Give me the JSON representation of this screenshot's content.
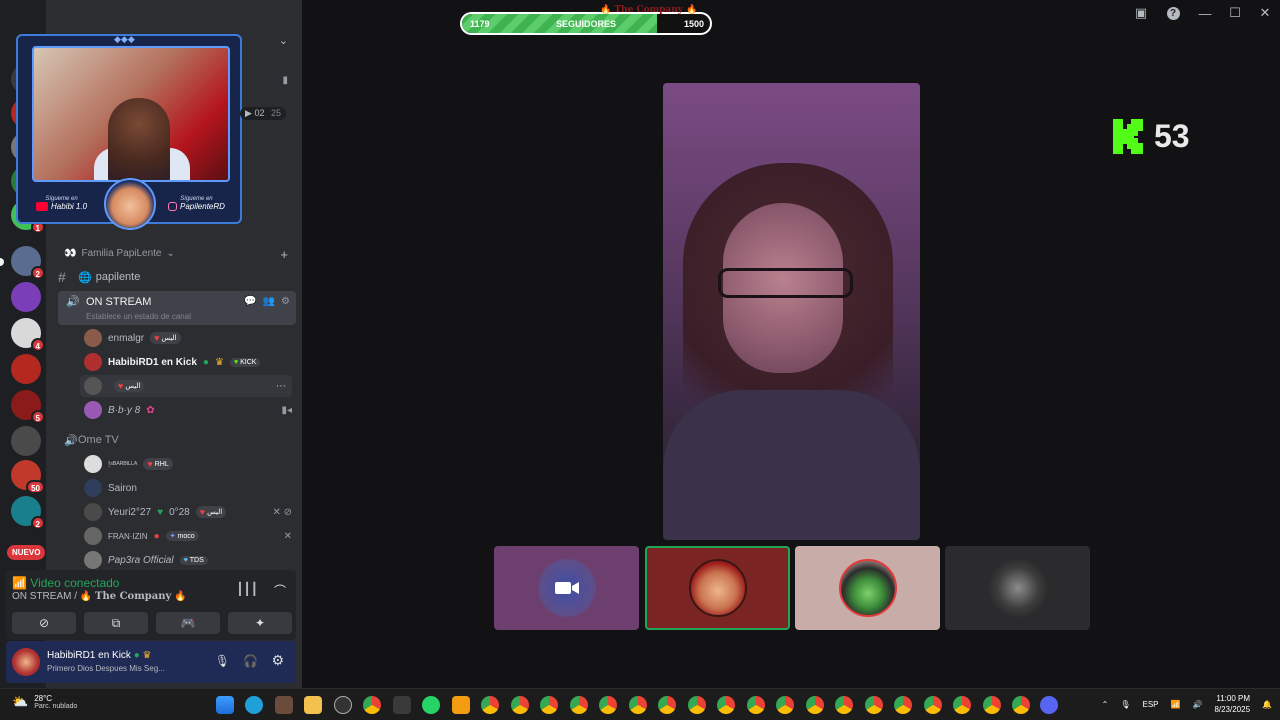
{
  "stream": {
    "follower_current": "1179",
    "follower_label": "SEGUIDORES",
    "follower_goal": "1500",
    "progress_fraction": 0.786,
    "banner_title": "The Company",
    "kick_count": "53"
  },
  "overlay": {
    "follow_left_small": "Sígueme en",
    "follow_left": "Habibi 1.0",
    "follow_right_small": "Sígueme en",
    "follow_right": "PapilenteRD",
    "cam_count": "02",
    "cam_count_2": "25"
  },
  "servers": {
    "badges": [
      "1",
      "2",
      "4",
      "5",
      "50",
      "2"
    ],
    "new_label": "NUEVO"
  },
  "sidebar": {
    "category": "Familia PapiLente",
    "text_channel": "papilente",
    "on_stream": {
      "name": "ON STREAM",
      "status": "Establece un estado de canal",
      "users": [
        {
          "name": "enmalgr",
          "tag": "اليس"
        },
        {
          "name": "HabibiRD1 en Kick",
          "tag": "KICK"
        },
        {
          "name": "",
          "tag": "اليس"
        },
        {
          "name": "B·b·y 8",
          "tag": ""
        }
      ]
    },
    "ome_tv": {
      "name": "Ome TV",
      "users": [
        {
          "name": "!ˢᴮᴬᴿᴮᴵᴸᴸᴬ",
          "tag": "RHL"
        },
        {
          "name": "Sairon",
          "tag": ""
        },
        {
          "name": "Yeuri2°27",
          "extra": "0°28",
          "tag": "اليس"
        },
        {
          "name": "FRAN·IZIN",
          "tag": "moco"
        },
        {
          "name": "Pap3ra Official",
          "tag": "TDS"
        }
      ]
    }
  },
  "voice_panel": {
    "status": "Video conectado",
    "channel": "ON STREAM /",
    "server": "The Company"
  },
  "user_bar": {
    "username": "HabibiRD1 en Kick",
    "status": "Primero Dios Despues Mis Seg..."
  },
  "taskbar": {
    "temp": "28°C",
    "weather": "Parc. nublado",
    "lang": "ESP",
    "time": "11:00 PM",
    "date": "8/23/2025"
  },
  "colors": {
    "accent_green": "#23a55a",
    "kick_green": "#53fc18",
    "danger": "#da373c"
  }
}
